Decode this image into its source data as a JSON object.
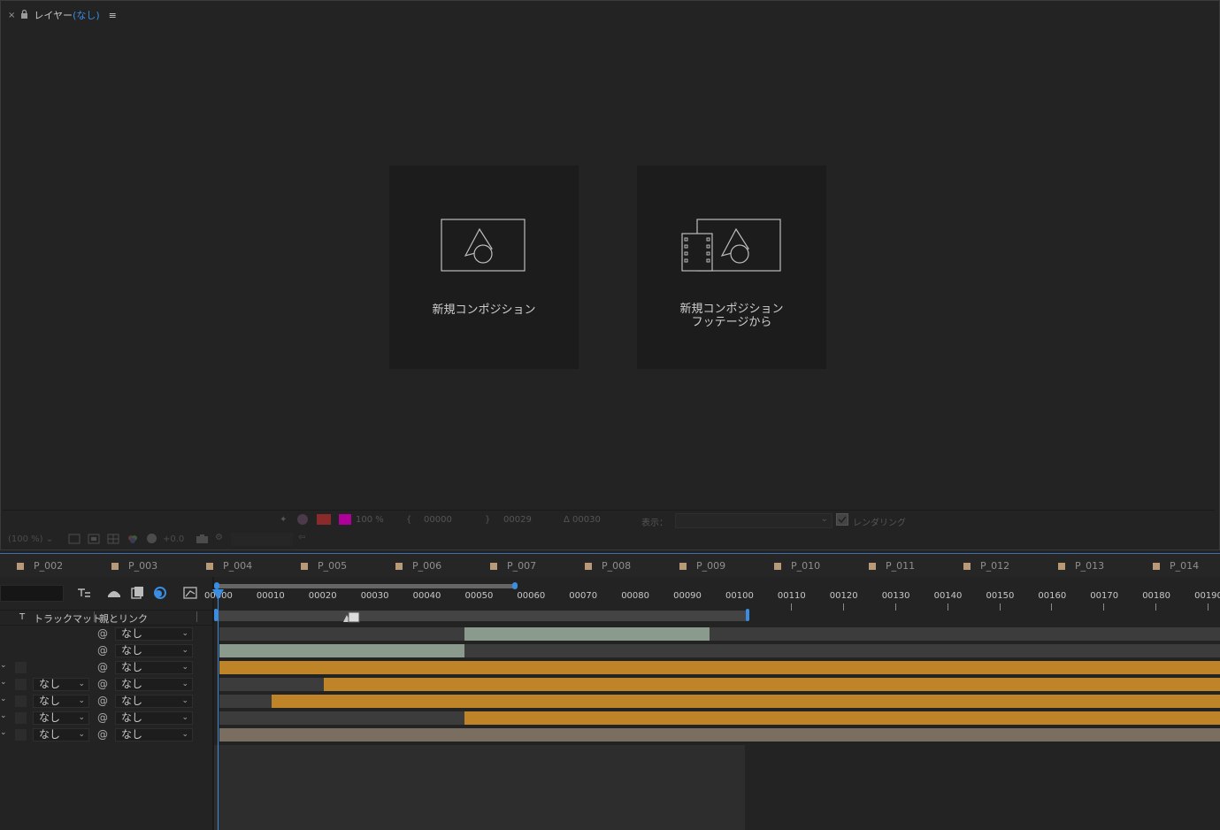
{
  "layer_panel": {
    "tab_title": "レイヤー",
    "tab_suffix": "(なし)",
    "close_glyph": "×",
    "menu_glyph": "≡",
    "cards": [
      {
        "label": "新規コンポジション"
      },
      {
        "label_line1": "新規コンポジション",
        "label_line2": "フッテージから"
      }
    ]
  },
  "info_bar": {
    "zoom_percent": "100 %",
    "in_point": "00000",
    "out_point": "00029",
    "duration": "Δ 00030",
    "view_label": "表示：",
    "render_label": "レンダリング"
  },
  "viewer_bar": {
    "zoom": "(100 %)",
    "exposure": "+0.0"
  },
  "markers": [
    "P_002",
    "P_003",
    "P_004",
    "P_005",
    "P_006",
    "P_007",
    "P_008",
    "P_009",
    "P_010",
    "P_011",
    "P_012",
    "P_013",
    "P_014"
  ],
  "timeline": {
    "col_track_matte": "トラックマット",
    "col_parent": "親とリンク",
    "t_label": "T",
    "rows": [
      {
        "matte": "",
        "parent": "なし",
        "has_swatch": false
      },
      {
        "matte": "",
        "parent": "なし",
        "has_swatch": false
      },
      {
        "matte": "",
        "parent": "なし",
        "has_swatch": true
      },
      {
        "matte": "なし",
        "parent": "なし",
        "has_swatch": true
      },
      {
        "matte": "なし",
        "parent": "なし",
        "has_swatch": true
      },
      {
        "matte": "なし",
        "parent": "なし",
        "has_swatch": true
      },
      {
        "matte": "なし",
        "parent": "なし",
        "has_swatch": true
      }
    ],
    "ruler_labels": [
      "00000",
      "00010",
      "00020",
      "00030",
      "00040",
      "00050",
      "00060",
      "00070",
      "00080",
      "00090",
      "00100",
      "00110",
      "00120",
      "00130",
      "00140",
      "00150",
      "00160",
      "00170",
      "00180",
      "00190"
    ],
    "work_area_end_frame": 100,
    "current_frame": 0,
    "comp_end_frame": 101,
    "layer_bars": [
      {
        "start": 47,
        "end": 94,
        "color": "#8a9a8c",
        "bg_start": 0
      },
      {
        "start": 0,
        "end": 47,
        "color": "#8a9a8c",
        "bg_start": 0
      },
      {
        "start": 0,
        "end": 193,
        "color": "#c08428",
        "bg_start": 0
      },
      {
        "start": 20,
        "end": 193,
        "color": "#c08428",
        "bg_start": 0
      },
      {
        "start": 10,
        "end": 193,
        "color": "#c08428",
        "bg_start": 0
      },
      {
        "start": 47,
        "end": 193,
        "color": "#c08428",
        "bg_start": 0
      },
      {
        "start": 0,
        "end": 193,
        "color": "#7a6e60",
        "bg_start": 0
      }
    ]
  },
  "colors": {
    "accent_blue": "#3a8de0",
    "label_magenta": "#b0009a",
    "label_red": "#8a2a2a"
  }
}
